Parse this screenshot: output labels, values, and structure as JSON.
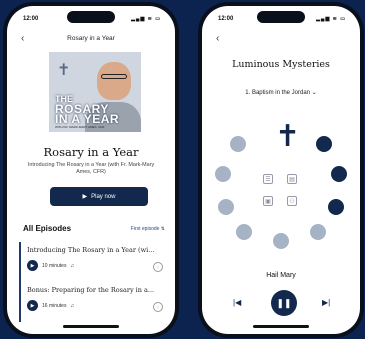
{
  "left_phone": {
    "status_time": "12:00",
    "status_icons": "▂▄▆ ≋ ▭",
    "back_icon": "chevron-left-icon",
    "nav_title": "Rosary in a Year",
    "cover": {
      "line1": "THE",
      "line2": "ROSARY",
      "line3": "IN A YEAR",
      "byline": "WITH FR. MARK-MARY AMES, CFR"
    },
    "podcast_title": "Rosary in a Year",
    "podcast_subtitle": "Introducing The Rosary in a Year (with Fr. Mark-Mary Ames, CFR)",
    "play_label": "Play now",
    "all_episodes_label": "All Episodes",
    "first_episode_label": "First episode ⇅",
    "episodes": [
      {
        "title": "Introducing The Rosary in a Year (wi...",
        "duration": "10 minutes"
      },
      {
        "title": "Bonus: Preparing for the Rosary in a...",
        "duration": "16 minutes"
      }
    ]
  },
  "right_phone": {
    "status_time": "12:00",
    "status_icons": "▂▄▆ ≋ ▭",
    "back_icon": "chevron-left-icon",
    "mystery_title": "Luminous Mysteries",
    "mystery_selected": "1. Baptism in the Jordan",
    "current_prayer": "Hail Mary",
    "colors": {
      "navy": "#12284d",
      "bead_light": "#a5b3c4"
    }
  }
}
